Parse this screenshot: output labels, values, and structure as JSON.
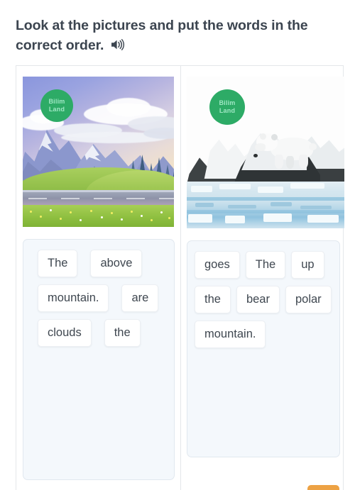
{
  "task": {
    "title": "Look at the pictures and put the words in the correct order.",
    "audio_icon": "speaker-icon"
  },
  "brand": {
    "logo_line1": "Bilim",
    "logo_line2": "Land",
    "logo_color": "#2dab66",
    "logo_text_color": "#9fe7c4"
  },
  "colors": {
    "heading": "#3c4550",
    "chip_text": "#3f4750",
    "dropzone_bg": "#f4f8fc",
    "dropzone_border": "#e1e8ef",
    "frame_border": "#e4e7ea",
    "accent_button": "#eda244"
  },
  "exercise": {
    "columns": [
      {
        "id": "column-1",
        "image": {
          "alt": "mountain landscape with green meadow, road and clouds",
          "name": "mountain-landscape-image"
        },
        "words": [
          "The",
          "above",
          "mountain.",
          "are",
          "clouds",
          "the"
        ]
      },
      {
        "id": "column-2",
        "image": {
          "alt": "polar bear walking on snowy rocks by icy water",
          "name": "polar-bear-image"
        },
        "words": [
          "goes",
          "The",
          "up",
          "the",
          "bear",
          "polar",
          "mountain."
        ]
      }
    ]
  },
  "footer": {
    "check_button_label": ""
  }
}
